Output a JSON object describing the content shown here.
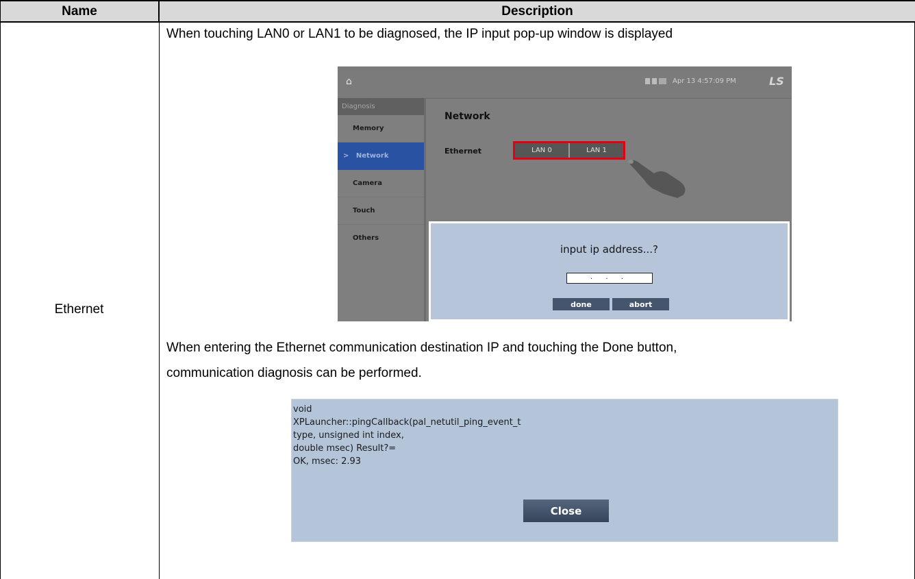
{
  "table": {
    "headers": {
      "name": "Name",
      "description": "Description"
    },
    "row": {
      "name": "Ethernet",
      "intro": "When touching LAN0 or LAN1 to be diagnosed, the IP input pop-up window is displayed",
      "followup_line1": "When entering the Ethernet communication destination IP and touching the Done button,",
      "followup_line2": "communication diagnosis can be performed."
    }
  },
  "device_screen": {
    "topbar": {
      "home_icon": "home-icon",
      "clock": "Apr 13 4:57:09 PM",
      "logo": "LS"
    },
    "sidebar": {
      "header": "Diagnosis",
      "items": [
        {
          "label": "Memory",
          "active": false
        },
        {
          "label": "Network",
          "active": true,
          "marker": ">"
        },
        {
          "label": "Camera",
          "active": false
        },
        {
          "label": "Touch",
          "active": false
        },
        {
          "label": "Others",
          "active": false
        }
      ]
    },
    "main": {
      "title": "Network",
      "ethernet_label": "Ethernet",
      "lan_buttons": [
        "LAN 0",
        "LAN 1"
      ],
      "highlight_color": "#e4000f"
    },
    "ip_dialog": {
      "prompt": "input ip address...?",
      "ip_value": ". . .",
      "done_label": "done",
      "abort_label": "abort"
    }
  },
  "ping_screen": {
    "lines": [
      "void",
      "XPLauncher::pingCallback(pal_netutil_ping_event_t",
      "type, unsigned int index,",
      "double msec) Result?=",
      "OK, msec: 2.93"
    ],
    "close_label": "Close"
  }
}
